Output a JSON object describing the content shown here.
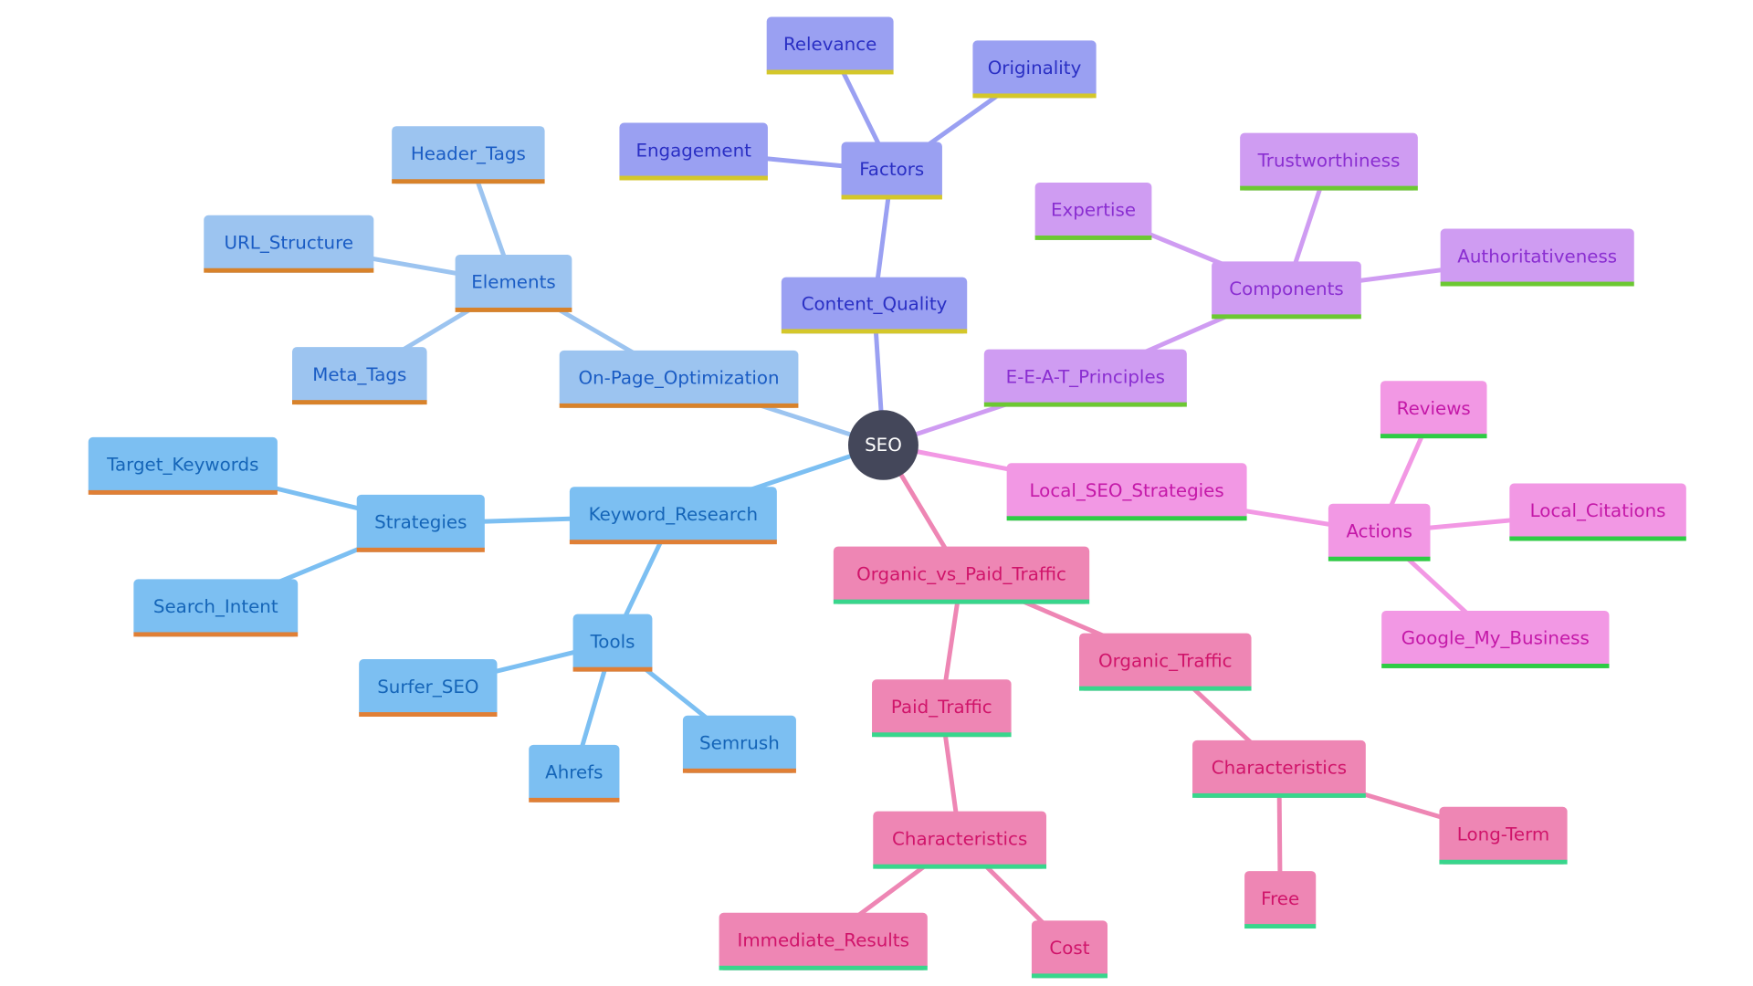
{
  "diagram": {
    "type": "mindmap",
    "root": {
      "id": "seo",
      "label": "SEO",
      "fill": "#44475a",
      "text_color": "#ffffff"
    },
    "branches": [
      {
        "id": "content_quality",
        "label": "Content_Quality",
        "fill": "#9aa0f2",
        "text_color": "#2a2fc4",
        "underline": "#d4c72a",
        "edge": "#9aa0f2",
        "children": [
          {
            "id": "factors",
            "label": "Factors",
            "children": [
              {
                "id": "relevance",
                "label": "Relevance"
              },
              {
                "id": "originality",
                "label": "Originality"
              },
              {
                "id": "engagement",
                "label": "Engagement"
              }
            ]
          }
        ]
      },
      {
        "id": "on_page",
        "label": "On-Page_Optimization",
        "fill": "#9cc4f0",
        "text_color": "#1a5cc4",
        "underline": "#d8822a",
        "edge": "#9cc4f0",
        "children": [
          {
            "id": "elements",
            "label": "Elements",
            "children": [
              {
                "id": "header_tags",
                "label": "Header_Tags"
              },
              {
                "id": "url_structure",
                "label": "URL_Structure"
              },
              {
                "id": "meta_tags",
                "label": "Meta_Tags"
              }
            ]
          }
        ]
      },
      {
        "id": "keyword_research",
        "label": "Keyword_Research",
        "fill": "#7cbff2",
        "text_color": "#1565b8",
        "underline": "#e07f35",
        "edge": "#7cbff2",
        "children": [
          {
            "id": "strategies",
            "label": "Strategies",
            "children": [
              {
                "id": "target_keywords",
                "label": "Target_Keywords"
              },
              {
                "id": "search_intent",
                "label": "Search_Intent"
              }
            ]
          },
          {
            "id": "tools",
            "label": "Tools",
            "children": [
              {
                "id": "surfer_seo",
                "label": "Surfer_SEO"
              },
              {
                "id": "ahrefs",
                "label": "Ahrefs"
              },
              {
                "id": "semrush",
                "label": "Semrush"
              }
            ]
          }
        ]
      },
      {
        "id": "eeat",
        "label": "E-E-A-T_Principles",
        "fill": "#cf9cf2",
        "text_color": "#8a2ed1",
        "underline": "#6cc832",
        "edge": "#cf9cf2",
        "children": [
          {
            "id": "components",
            "label": "Components",
            "children": [
              {
                "id": "expertise",
                "label": "Expertise"
              },
              {
                "id": "trustworthiness",
                "label": "Trustworthiness"
              },
              {
                "id": "authoritativeness",
                "label": "Authoritativeness"
              }
            ]
          }
        ]
      },
      {
        "id": "local_seo",
        "label": "Local_SEO_Strategies",
        "fill": "#f298e4",
        "text_color": "#c418a8",
        "underline": "#2ecc44",
        "edge": "#f298e4",
        "children": [
          {
            "id": "actions",
            "label": "Actions",
            "children": [
              {
                "id": "reviews",
                "label": "Reviews"
              },
              {
                "id": "local_citations",
                "label": "Local_Citations"
              },
              {
                "id": "google_my_business",
                "label": "Google_My_Business"
              }
            ]
          }
        ]
      },
      {
        "id": "organic_vs_paid",
        "label": "Organic_vs_Paid_Traffic",
        "fill": "#ee86b4",
        "text_color": "#d0146a",
        "underline": "#38d68c",
        "edge": "#ee86b4",
        "children": [
          {
            "id": "paid_traffic",
            "label": "Paid_Traffic",
            "children": [
              {
                "id": "paid_characteristics",
                "label": "Characteristics",
                "children": [
                  {
                    "id": "immediate_results",
                    "label": "Immediate_Results"
                  },
                  {
                    "id": "cost",
                    "label": "Cost"
                  }
                ]
              }
            ]
          },
          {
            "id": "organic_traffic",
            "label": "Organic_Traffic",
            "children": [
              {
                "id": "organic_characteristics",
                "label": "Characteristics",
                "children": [
                  {
                    "id": "free",
                    "label": "Free"
                  },
                  {
                    "id": "long_term",
                    "label": "Long-Term"
                  }
                ]
              }
            ]
          }
        ]
      }
    ]
  }
}
